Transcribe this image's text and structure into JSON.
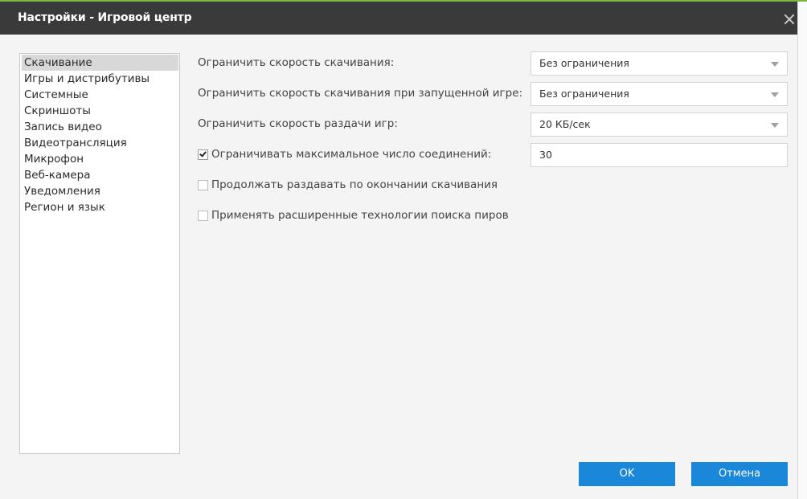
{
  "window": {
    "title": "Настройки - Игровой центр",
    "accent_color": "#7bb73d",
    "titlebar_color": "#3a3a3a"
  },
  "sidebar": {
    "items": [
      {
        "label": "Скачивание",
        "selected": true
      },
      {
        "label": "Игры и дистрибутивы"
      },
      {
        "label": "Системные"
      },
      {
        "label": "Скриншоты"
      },
      {
        "label": "Запись видео"
      },
      {
        "label": "Видеотрансляция"
      },
      {
        "label": "Микрофон"
      },
      {
        "label": "Веб-камера"
      },
      {
        "label": "Уведомления"
      },
      {
        "label": "Регион и язык"
      }
    ]
  },
  "settings": {
    "download_limit": {
      "label": "Ограничить скорость скачивания:",
      "value": "Без ограничения"
    },
    "download_limit_ingame": {
      "label": "Ограничить скорость скачивания при запущенной игре:",
      "value": "Без ограничения"
    },
    "seed_limit": {
      "label": "Ограничить скорость раздачи игр:",
      "value": "20 КБ/сек"
    },
    "max_connections": {
      "label": "Ограничивать максимальное число соединений:",
      "checked": true,
      "value": "30"
    },
    "continue_seeding": {
      "label": "Продолжать раздавать по окончании скачивания",
      "checked": false
    },
    "advanced_peer_search": {
      "label": "Применять расширенные технологии поиска пиров",
      "checked": false
    }
  },
  "buttons": {
    "ok": "OK",
    "cancel": "Отмена",
    "color": "#1a87d8"
  },
  "icons": {
    "close": "close-icon",
    "dropdown": "chevron-down-icon",
    "check": "check-icon"
  }
}
